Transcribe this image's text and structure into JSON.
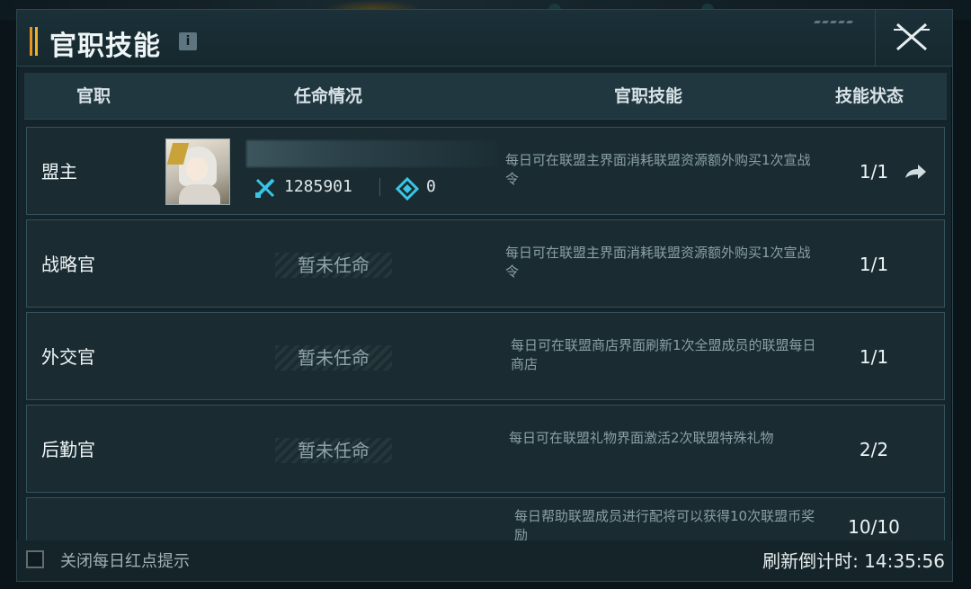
{
  "header": {
    "title": "官职技能",
    "info_icon": "i"
  },
  "table": {
    "columns": [
      "官职",
      "任命情况",
      "官职技能",
      "技能状态"
    ],
    "rows": [
      {
        "post": "盟主",
        "appointee": {
          "power": "1285901",
          "gems": "0"
        },
        "skill": "每日可在联盟主界面消耗联盟资源额外购买1次宣战令",
        "status": "1/1"
      },
      {
        "post": "战略官",
        "appointment": "暂未任命",
        "skill": "每日可在联盟主界面消耗联盟资源额外购买1次宣战令",
        "status": "1/1"
      },
      {
        "post": "外交官",
        "appointment": "暂未任命",
        "skill": "每日可在联盟商店界面刷新1次全盟成员的联盟每日商店",
        "status": "1/1"
      },
      {
        "post": "后勤官",
        "appointment": "暂未任命",
        "skill": "每日可在联盟礼物界面激活2次联盟特殊礼物",
        "status": "2/2"
      },
      {
        "post": "",
        "appointment": "",
        "skill": "每日帮助联盟成员进行配将可以获得10次联盟币奖励",
        "status": "10/10"
      }
    ]
  },
  "footer": {
    "checkbox_label": "关闭每日红点提示",
    "countdown_label": "刷新倒计时: 14:35:56"
  },
  "colors": {
    "accent": "#e8961f",
    "panel": "#14242a",
    "row": "#1a2c32",
    "cyan_icon": "#38c6e6"
  }
}
